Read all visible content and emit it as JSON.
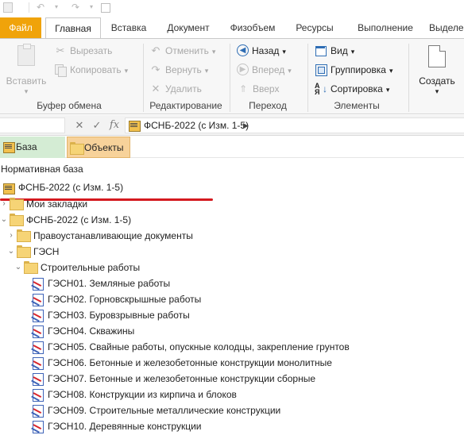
{
  "tabs": {
    "file": "Файл",
    "home": "Главная",
    "insert": "Вставка",
    "document": "Документ",
    "volume": "Физобъем",
    "resources": "Ресурсы",
    "execution": "Выполнение",
    "select": "Выделе"
  },
  "ribbon": {
    "clipboard": {
      "paste": "Вставить",
      "cut": "Вырезать",
      "copy": "Копировать",
      "label": "Буфер обмена"
    },
    "editing": {
      "undo": "Отменить",
      "redo": "Вернуть",
      "delete": "Удалить",
      "label": "Редактирование"
    },
    "navigation": {
      "back": "Назад",
      "forward": "Вперед",
      "up": "Вверх",
      "label": "Переход"
    },
    "elements": {
      "view": "Вид",
      "grouping": "Группировка",
      "sorting": "Сортировка",
      "label": "Элементы"
    },
    "create": {
      "label": "Создать"
    }
  },
  "address_bar": {
    "fx": "fx",
    "path": "ФСНБ-2022 (с Изм. 1-5)"
  },
  "doc_tabs": {
    "base": "База",
    "objects": "Объекты"
  },
  "tree": {
    "title": "Нормативная база",
    "selected_base": "ФСНБ-2022 (с Изм. 1-5)",
    "bookmarks": "Мои закладки",
    "base_node": "ФСНБ-2022 (с Изм. 1-5)",
    "legal_docs": "Правоустанавливающие документы",
    "gesn": "ГЭСН",
    "construction": "Строительные работы",
    "items": [
      "ГЭСН01. Земляные работы",
      "ГЭСН02. Горновскрышные работы",
      "ГЭСН03. Буровзрывные работы",
      "ГЭСН04. Скважины",
      "ГЭСН05. Свайные работы, опускные колодцы, закрепление грунтов",
      "ГЭСН06. Бетонные и железобетонные конструкции монолитные",
      "ГЭСН07. Бетонные и железобетонные конструкции сборные",
      "ГЭСН08. Конструкции из кирпича и блоков",
      "ГЭСН09. Строительные металлические конструкции",
      "ГЭСН10. Деревянные конструкции"
    ]
  },
  "colors": {
    "file_tab": "#f0a30a",
    "base_tab": "#d4ecd4",
    "objects_tab": "#f7d29a",
    "highlight_line": "#d4191f",
    "nav_accent": "#2e6db4"
  }
}
